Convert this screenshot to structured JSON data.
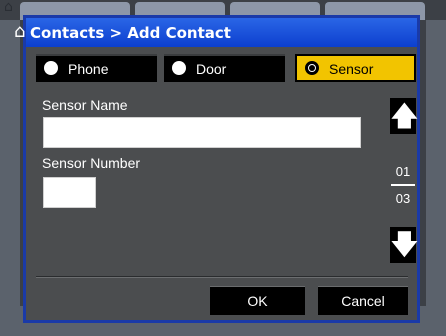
{
  "window": {
    "title": "Contacts > Add Contact"
  },
  "contact_type": {
    "options": [
      {
        "label": "Phone",
        "selected": false
      },
      {
        "label": "Door",
        "selected": false
      },
      {
        "label": "Sensor",
        "selected": true
      }
    ]
  },
  "form": {
    "sensor_name": {
      "label": "Sensor Name",
      "value": ""
    },
    "sensor_number": {
      "label": "Sensor Number",
      "value": ""
    }
  },
  "pager": {
    "current": "01",
    "total": "03"
  },
  "icons": {
    "home": "home-icon",
    "up": "up-arrow-icon",
    "down": "down-arrow-icon"
  },
  "buttons": {
    "ok": "OK",
    "cancel": "Cancel"
  },
  "colors": {
    "title_bar": "#1a55e0",
    "selected_radio": "#f2c400",
    "dialog_bg": "#4b4d4f"
  }
}
